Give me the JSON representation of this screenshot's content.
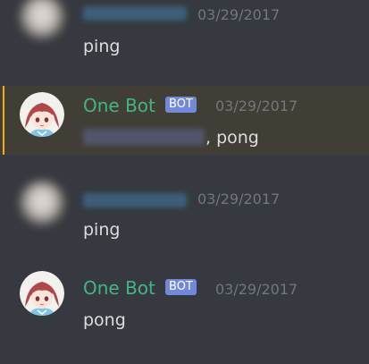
{
  "messages": [
    {
      "author": "",
      "timestamp": "03/29/2017",
      "content": "ping"
    },
    {
      "author": "One Bot",
      "badge": "BOT",
      "timestamp": "03/29/2017",
      "content_suffix": ", pong",
      "mentioned": true
    },
    {
      "author": "",
      "timestamp": "03/29/2017",
      "content": "ping"
    },
    {
      "author": "One Bot",
      "badge": "BOT",
      "timestamp": "03/29/2017",
      "content": "pong"
    }
  ],
  "colors": {
    "background": "#36393f",
    "mention_highlight": "#413e36",
    "mention_bar": "#faa81a",
    "bot_name": "#43b581",
    "bot_badge": "#7289da",
    "timestamp": "#72767d",
    "text": "#dcddde"
  }
}
